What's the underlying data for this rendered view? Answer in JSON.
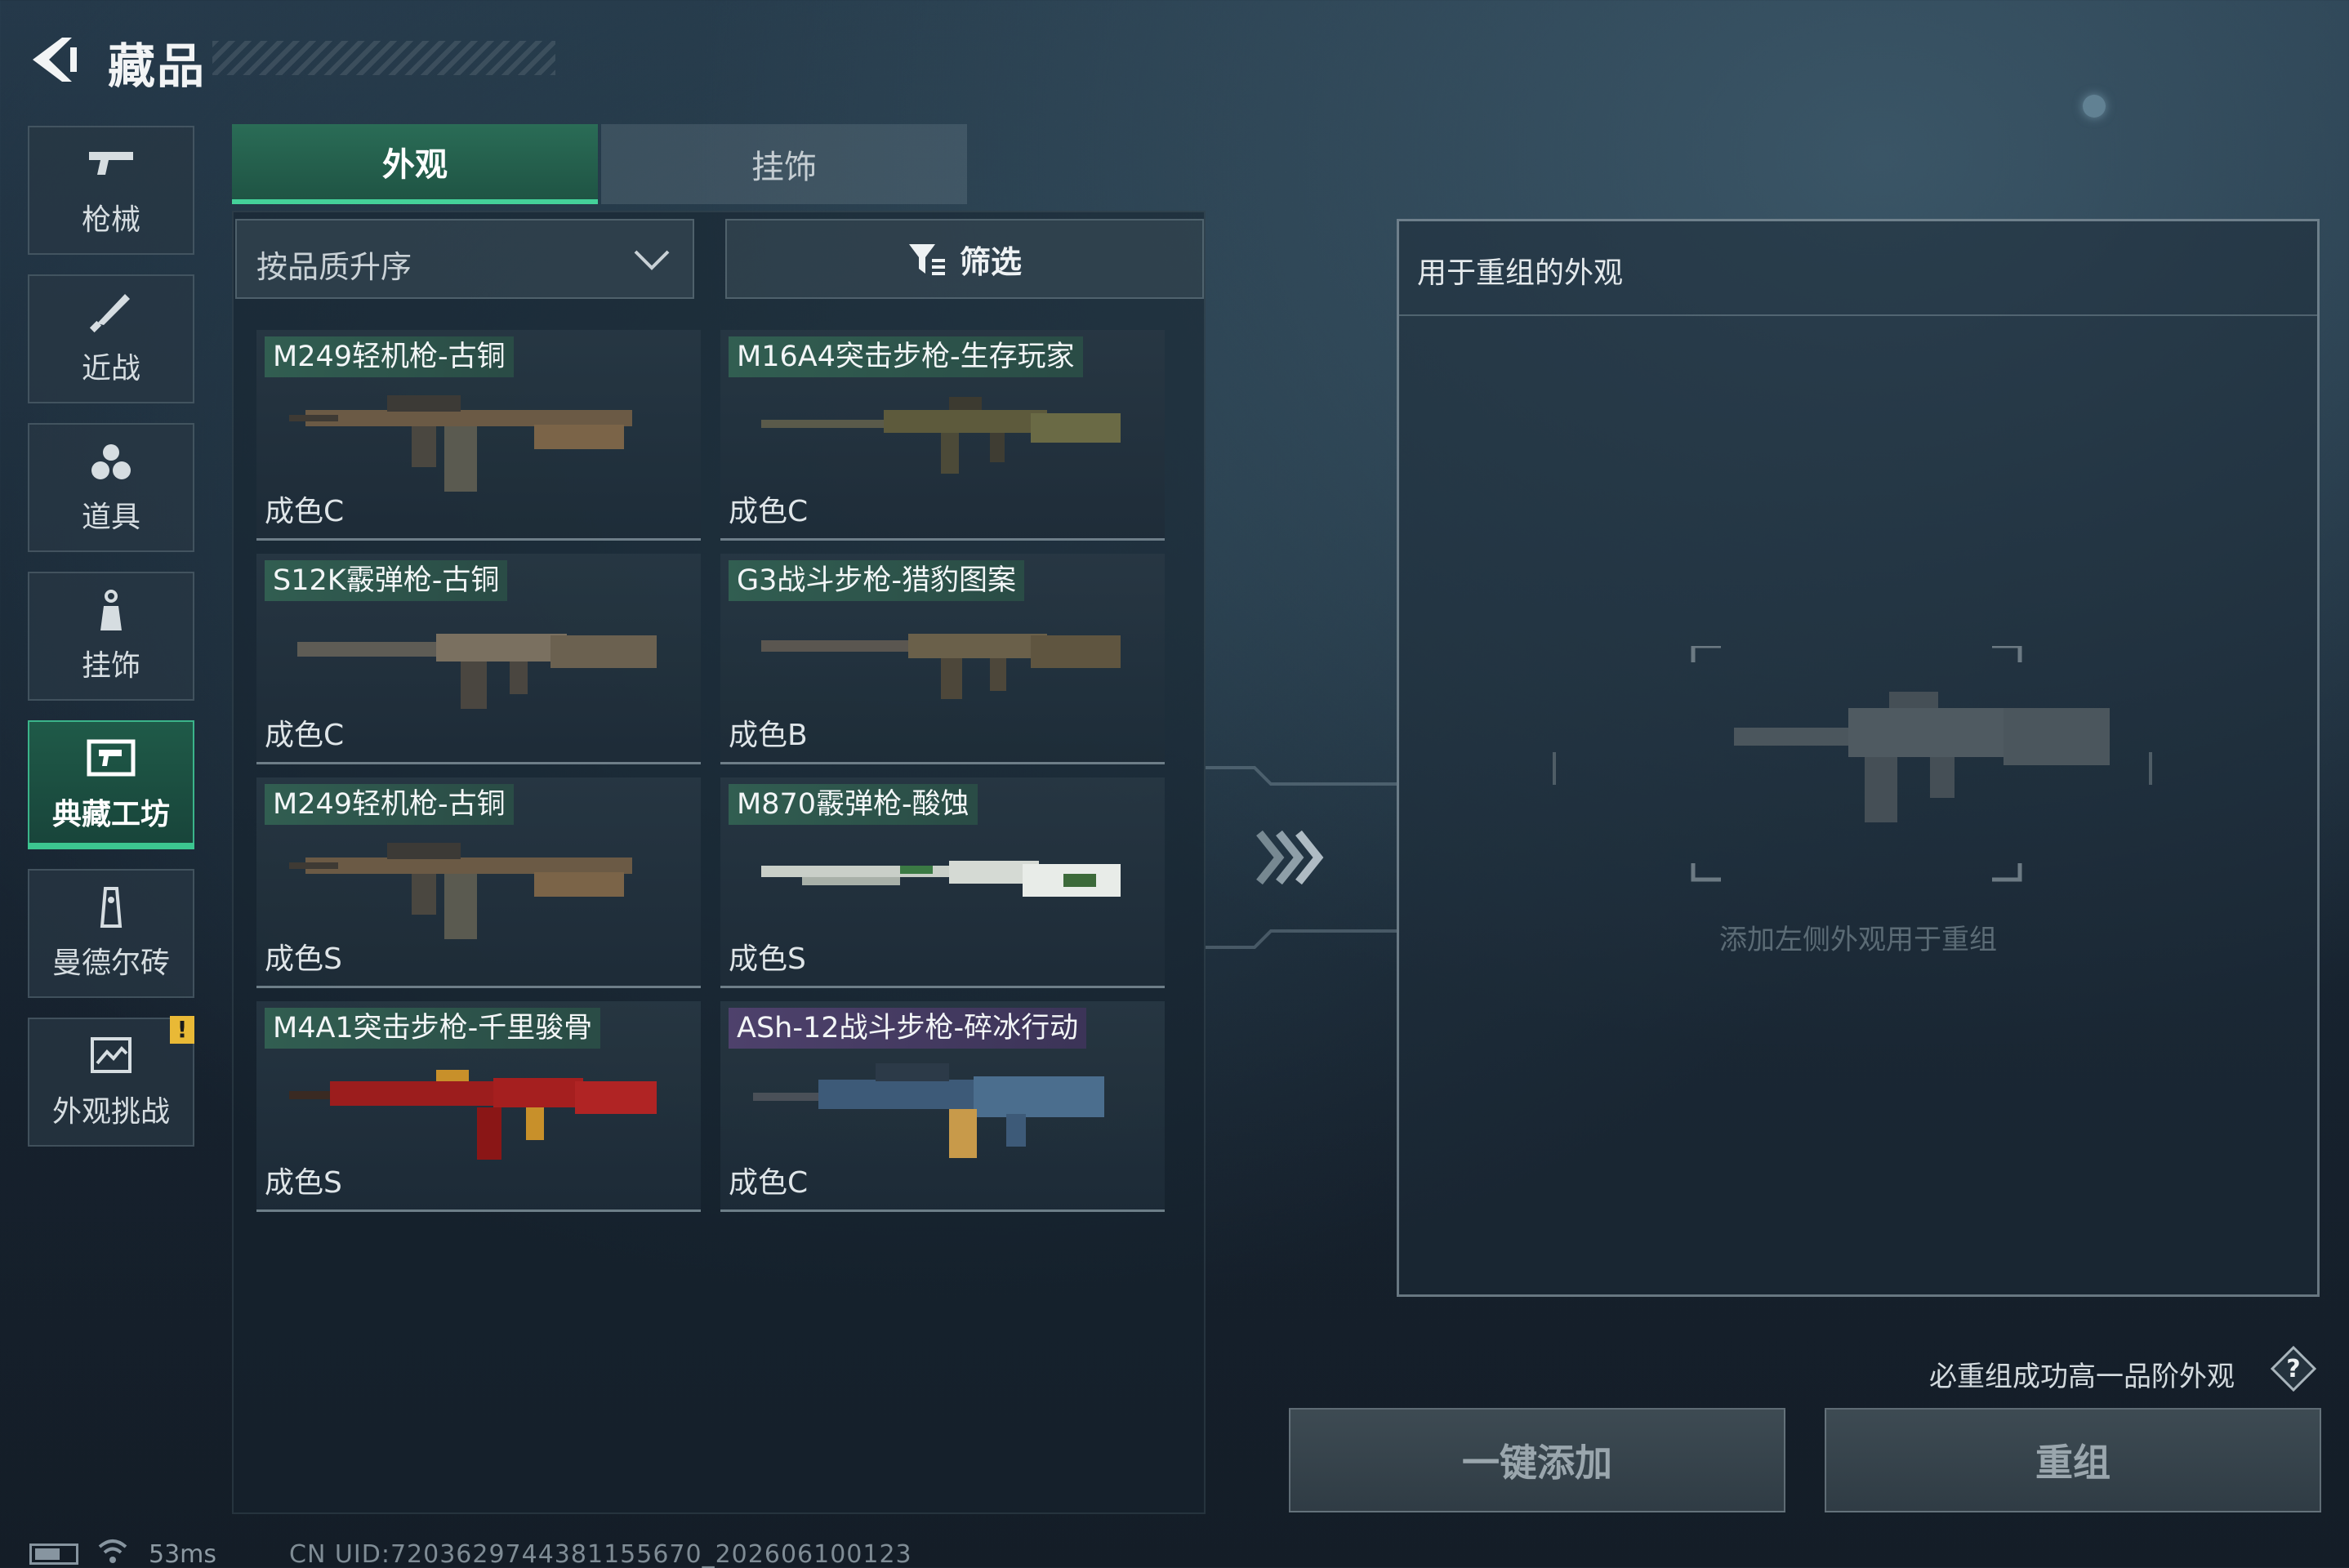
{
  "header": {
    "title": "藏品"
  },
  "sidebar": {
    "items": [
      {
        "label": "枪械"
      },
      {
        "label": "近战"
      },
      {
        "label": "道具"
      },
      {
        "label": "挂饰"
      },
      {
        "label": "典藏工坊",
        "active": true
      },
      {
        "label": "曼德尔砖"
      },
      {
        "label": "外观挑战",
        "badge": "!"
      }
    ]
  },
  "tabs": [
    {
      "label": "外观",
      "active": true
    },
    {
      "label": "挂饰"
    }
  ],
  "toolbar": {
    "sort_label": "按品质升序",
    "filter_label": "筛选"
  },
  "items": [
    {
      "name": "M249轻机枪-古铜",
      "grade": "成色C"
    },
    {
      "name": "M16A4突击步枪-生存玩家",
      "grade": "成色C"
    },
    {
      "name": "S12K霰弹枪-古铜",
      "grade": "成色C"
    },
    {
      "name": "G3战斗步枪-猎豹图案",
      "grade": "成色B"
    },
    {
      "name": "M249轻机枪-古铜",
      "grade": "成色S"
    },
    {
      "name": "M870霰弹枪-酸蚀",
      "grade": "成色S"
    },
    {
      "name": "M4A1突击步枪-千里骏骨",
      "grade": "成色S"
    },
    {
      "name": "ASh-12战斗步枪-碎冰行动",
      "grade": "成色C"
    }
  ],
  "reorg": {
    "title": "用于重组的外观",
    "placeholder": "添加左侧外观用于重组",
    "guarantee": "必重组成功高一品阶外观",
    "add_button": "一键添加",
    "reorg_button": "重组"
  },
  "status": {
    "ping": "53ms",
    "uid": "CN UID:72036297443811556​70_202606100123"
  },
  "colors": {
    "accent": "#3cc690",
    "warning": "#e9b936"
  }
}
